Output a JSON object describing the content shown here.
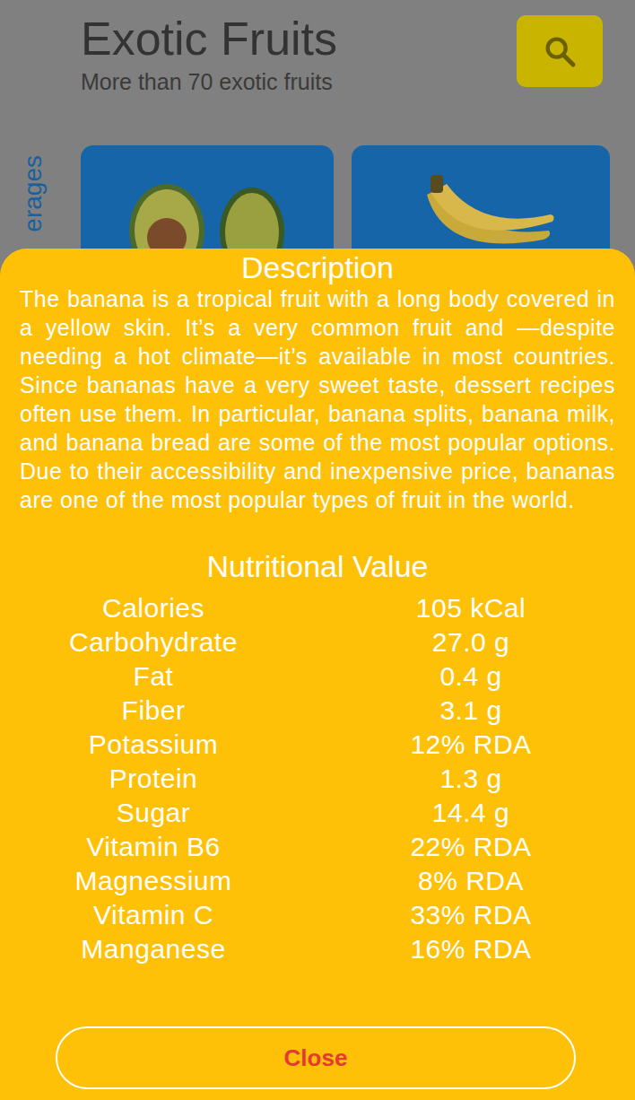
{
  "header": {
    "title": "Exotic Fruits",
    "subtitle": "More than 70 exotic fruits"
  },
  "category_label": "erages",
  "sheet": {
    "heading": "Description",
    "description": "The banana is a tropical fruit with a long body covered in a yellow skin.  It’s a very common fruit and —despite needing a hot climate—it’s available in most countries.  Since bananas have a very sweet taste, dessert recipes often use them.  In particular, banana splits, banana milk, and banana bread are some of the most popular options.  Due to their accessibility and inexpensive price, bananas are one of the most popular types of fruit in the world.",
    "nutrition_heading": "Nutritional Value",
    "nutrients": [
      {
        "name": "Calories",
        "value": "105 kCal"
      },
      {
        "name": "Carbohydrate",
        "value": "27.0 g"
      },
      {
        "name": "Fat",
        "value": "0.4 g"
      },
      {
        "name": "Fiber",
        "value": "3.1 g"
      },
      {
        "name": "Potassium",
        "value": "12% RDA"
      },
      {
        "name": "Protein",
        "value": "1.3 g"
      },
      {
        "name": "Sugar",
        "value": "14.4 g"
      },
      {
        "name": "Vitamin B6",
        "value": "22% RDA"
      },
      {
        "name": "Magnessium",
        "value": "8% RDA"
      },
      {
        "name": "Vitamin C",
        "value": "33% RDA"
      },
      {
        "name": "Manganese",
        "value": "16% RDA"
      }
    ],
    "close_button": "Close"
  }
}
